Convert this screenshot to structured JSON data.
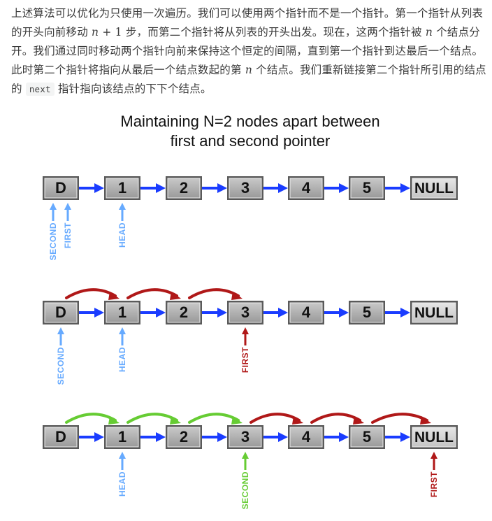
{
  "paragraph": {
    "p1": "上述算法可以优化为只使用一次遍历。我们可以使用两个指针而不是一个指针。第一个指针从列表的开头向前移动 ",
    "m1": "n",
    "m2": " + 1",
    "p2": " 步，而第二个指针将从列表的开头出发。现在，这两个指针被 ",
    "m3": "n",
    "p3": " 个结点分开。我们通过同时移动两个指针向前来保持这个恒定的间隔，直到第一个指针到达最后一个结点。此时第二个指针将指向从最后一个结点数起的第 ",
    "m4": "n",
    "p4": " 个结点。我们重新链接第二个指针所引用的结点的 ",
    "code": "next",
    "p5": " 指针指向该结点的下下个结点。"
  },
  "figure": {
    "title_line1": "Maintaining N=2 nodes apart between",
    "title_line2": "first and second pointer",
    "nodes": [
      "D",
      "1",
      "2",
      "3",
      "4",
      "5",
      "NULL"
    ],
    "pointer_labels": {
      "second": "SECOND",
      "first": "FIRST",
      "head": "HEAD"
    },
    "colors": {
      "node_fill": "#a9a9a9",
      "null_fill": "#d4d4d4",
      "link_arrow": "#1a3cff",
      "blue_pointer": "#66aaff",
      "red_pointer": "#b01818",
      "green_pointer": "#66cc33"
    }
  }
}
